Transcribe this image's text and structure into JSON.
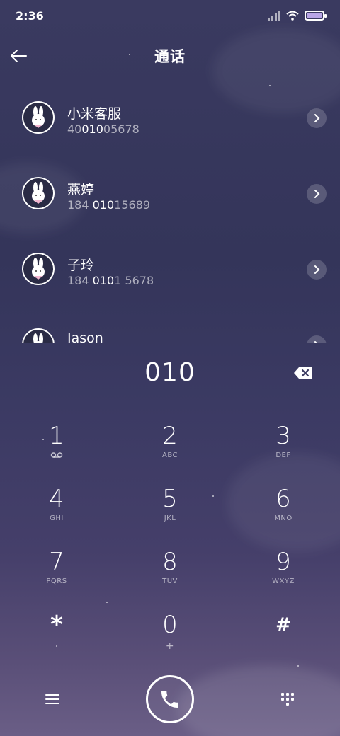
{
  "status_bar": {
    "time": "2:36"
  },
  "header": {
    "title": "通话"
  },
  "contacts": [
    {
      "name": "小米客服",
      "number_pre": "40",
      "number_match": "010",
      "number_post": "05678"
    },
    {
      "name": "燕婷",
      "number_pre": "184 ",
      "number_match": "010",
      "number_post": "15689"
    },
    {
      "name": "子玲",
      "number_pre": "184 ",
      "number_match": "010",
      "number_post": "1 5678"
    },
    {
      "name": "Jason",
      "number_pre": "",
      "number_match": "",
      "number_post": ""
    }
  ],
  "dial": {
    "number": "010"
  },
  "keypad": [
    {
      "digit": "1",
      "sub": ""
    },
    {
      "digit": "2",
      "sub": "ABC"
    },
    {
      "digit": "3",
      "sub": "DEF"
    },
    {
      "digit": "4",
      "sub": "GHI"
    },
    {
      "digit": "5",
      "sub": "JKL"
    },
    {
      "digit": "6",
      "sub": "MNO"
    },
    {
      "digit": "7",
      "sub": "PQRS"
    },
    {
      "digit": "8",
      "sub": "TUV"
    },
    {
      "digit": "9",
      "sub": "WXYZ"
    },
    {
      "digit": "*",
      "sub": ","
    },
    {
      "digit": "0",
      "sub": "+"
    },
    {
      "digit": "#",
      "sub": ""
    }
  ],
  "colors": {
    "background": "#3a3a60",
    "accent": "#b9a6e6"
  },
  "icons": {
    "back": "arrow-left-icon",
    "chevron": "chevron-right-icon",
    "backspace": "backspace-icon",
    "voicemail": "voicemail-icon",
    "menu": "menu-icon",
    "call": "phone-icon",
    "dialpad": "dialpad-icon"
  }
}
